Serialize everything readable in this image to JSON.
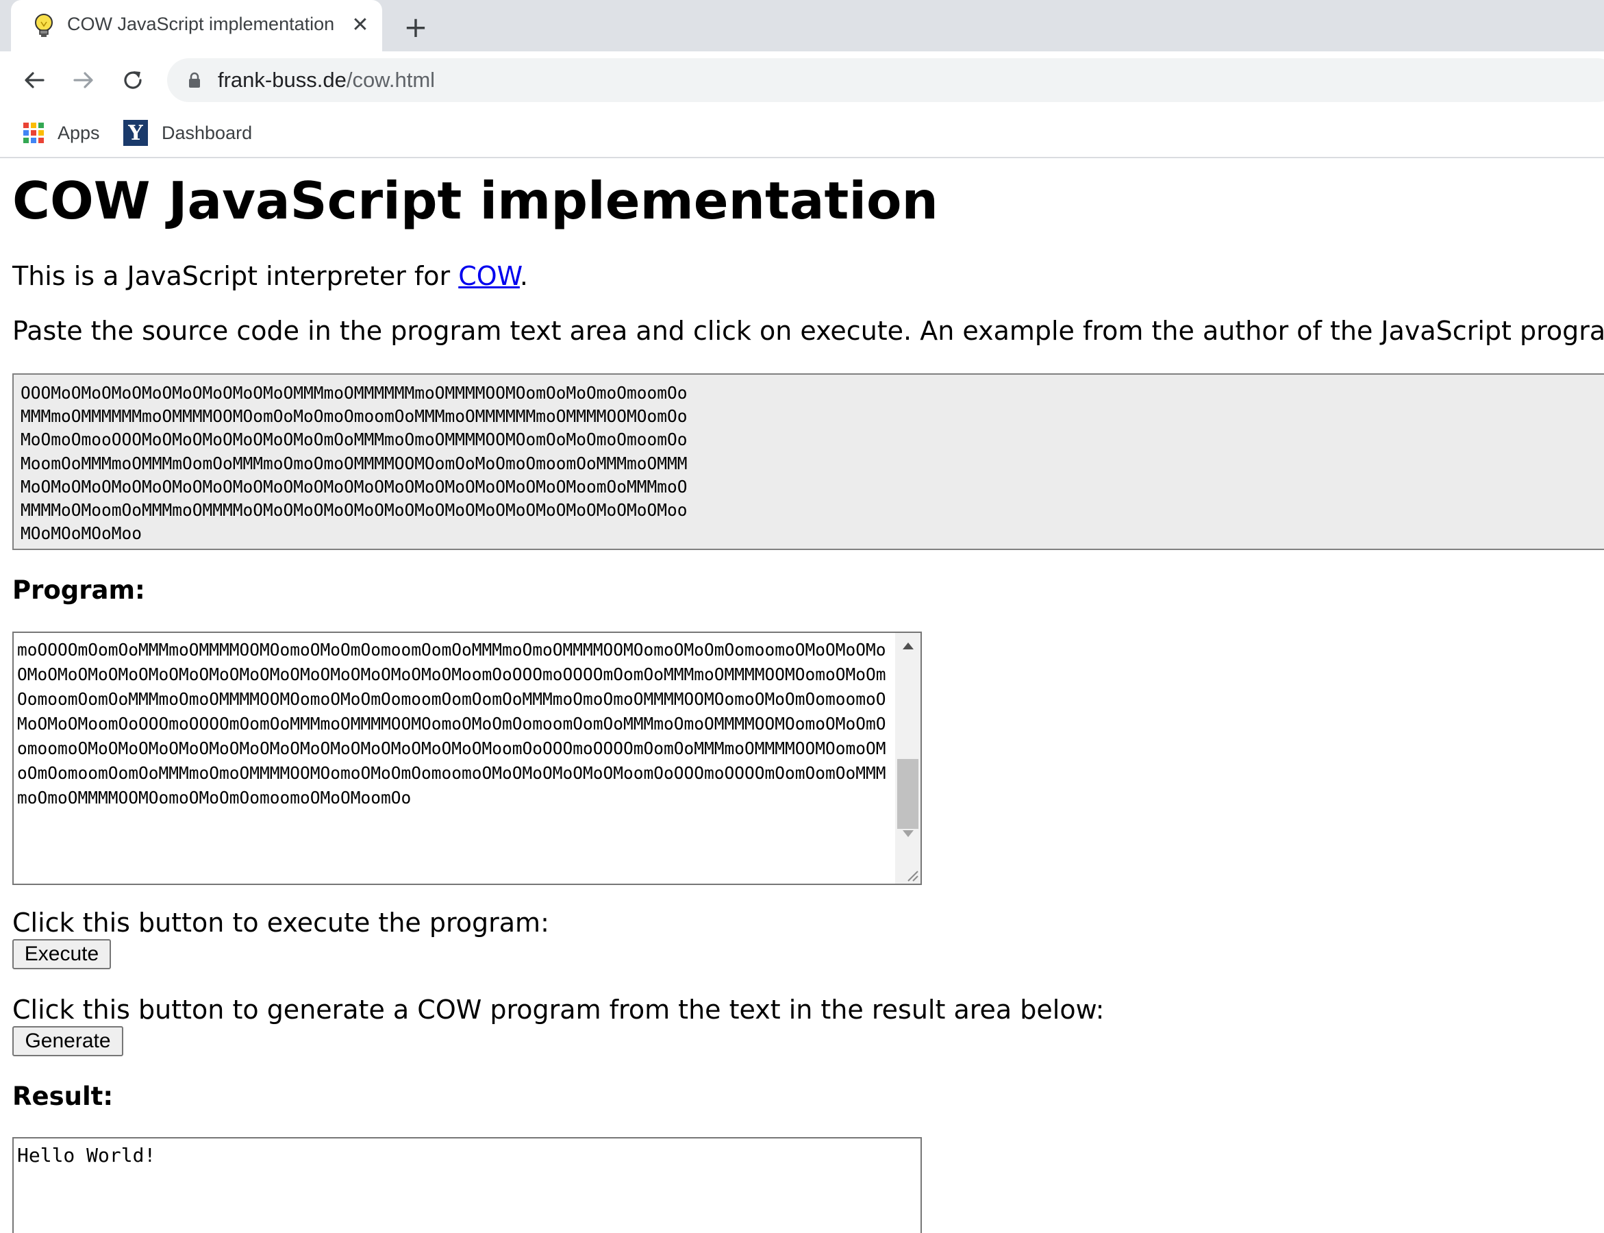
{
  "browser": {
    "tab_title": "COW JavaScript implementation",
    "tab_close": "✕",
    "new_tab": "+",
    "url_host": "frank-buss.de",
    "url_path": "/cow.html",
    "bookmarks": [
      {
        "label": "Apps",
        "icon": "apps-grid-icon"
      },
      {
        "label": "Dashboard",
        "icon": "y-logo-icon",
        "icon_text": "Y"
      }
    ],
    "apps_colors": [
      "#ea4335",
      "#fbbc05",
      "#34a853",
      "#4285f4",
      "#ea4335",
      "#fbbc05",
      "#34a853",
      "#4285f4",
      "#ea4335"
    ]
  },
  "page": {
    "title": "COW JavaScript implementation",
    "intro_prefix": "This is a JavaScript interpreter for ",
    "intro_link": "COW",
    "intro_suffix": ".",
    "paste_instructions": "Paste the source code in the program text area and click on execute. An example from the author of the JavaScript program:",
    "example_code": "OOOMoOMoOMoOMoOMoOMoOMoOMoOMMMmoOMMMMMMmoOMMMMOOMOomOoMoOmoOmoomOo\nMMMmoOMMMMMMmoOMMMMOOMOomOoMoOmoOmoomOoMMMmoOMMMMMMmoOMMMMOOMOomOo\nMoOmoOmooOOOMoOMoOMoOMoOMoOMoOmOoMMMmoOmoOMMMMOOMOomOoMoOmoOmoomOo\nMoomOoMMMmoOMMMmOomOoMMMmoOmoOmoOMMMMOOMOomOoMoOmoOmoomOoMMMmoOMMM\nMoOMoOMoOMoOMoOMoOMoOMoOMoOMoOMoOMoOMoOMoOMoOMoOMoOMoOMoomOoMMMmoO\nMMMMoOMoomOoMMMmoOMMMMoOMoOMoOMoOMoOMoOMoOMoOMoOMoOMoOMoOMoOMoOMoo\nMOoMOoMOoMoo",
    "program_label": "Program:",
    "program_code": "moOOOOmOomOoMMMmoOMMMMOOMOomoOMoOmOomoomOomOoMMMmoOmoOMMMMOOMOomoOMoOmOomoomoOMoOMoOMoOMoOMoOMoOMoOMoOMoOMoOMoOMoOMoOMoOMoOMoOMoOMoomOoOOOmoOOOOmOomOoMMMmoOMMMMOOMOomoOMoOmOomoomOomOoMMMmoOmoOMMMMOOMOomoOMoOmOomoomOomOomOoMMMmoOmoOmoOMMMMOOMOomoOMoOmOomoomoOMoOMoOMoomOoOOOmoOOOOmOomOoMMMmoOMMMMOOMOomoOMoOmOomoomOomOoMMMmoOmoOMMMMOOMOomoOMoOmOomoomoOMoOMoOMoOMoOMoOMoOMoOMoOMoOMoOMoOMoOMoOMoomOoOOOmoOOOOmOomOoMMMmoOMMMMOOMOomoOMoOmOomoomOomOoMMMmoOmoOMMMMOOMOomoOMoOmOomoomoOMoOMoOMoOMoOMoomOoOOOmoOOOOmOomOomOoMMMmoOmoOMMMMOOMOomoOMoOmOomoomoOMoOMoomOo",
    "execute_prompt": "Click this button to execute the program:",
    "execute_button": "Execute",
    "generate_prompt": "Click this button to generate a COW program from the text in the result area below:",
    "generate_button": "Generate",
    "result_label": "Result:",
    "result_text": "Hello World!"
  },
  "colors": {
    "link": "#0000ee",
    "tabstrip_bg": "#dee1e6",
    "omnibox_bg": "#f1f3f4",
    "example_bg": "#ececec"
  }
}
